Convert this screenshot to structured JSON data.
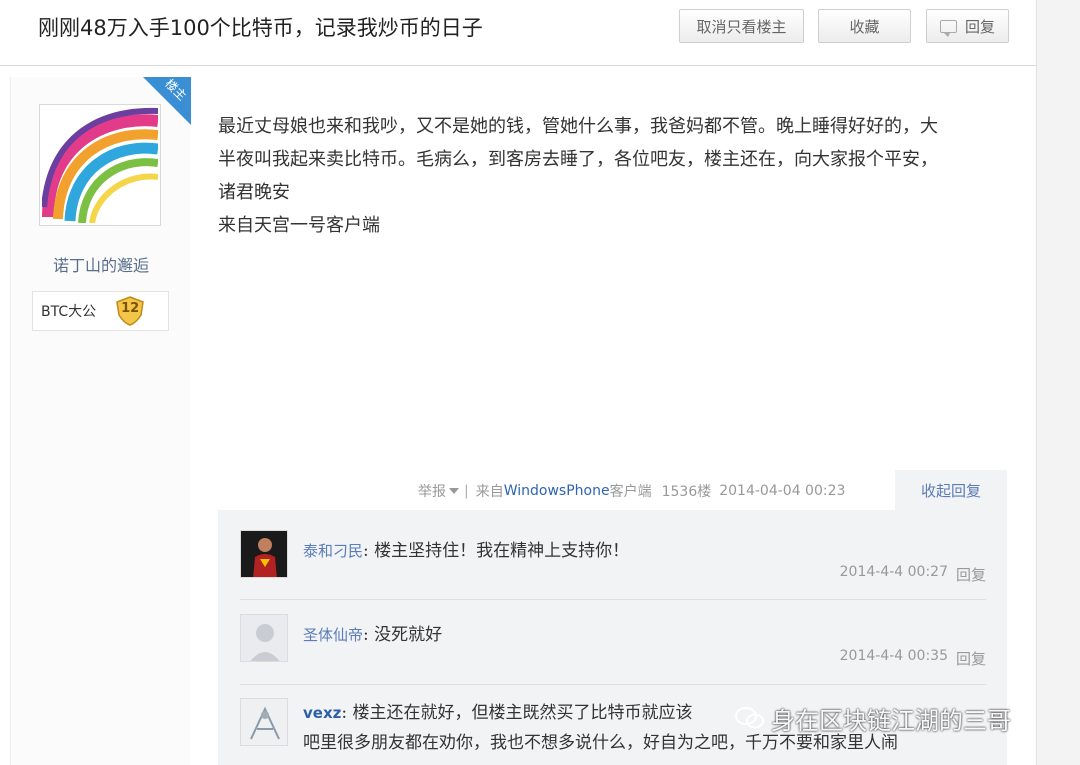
{
  "header": {
    "title": "刚刚48万入手100个比特币，记录我炒币的日子",
    "cancel_only_op_label": "取消只看楼主",
    "favorite_label": "收藏",
    "reply_label": "回复"
  },
  "author": {
    "badge": "楼主",
    "username": "诺丁山的邂逅",
    "level_name": "BTC大公",
    "level": "12"
  },
  "post": {
    "lines": [
      "最近丈母娘也来和我吵，又不是她的钱，管她什么事，我爸妈都不管。晚上睡得好好的，大",
      "半夜叫我起来卖比特币。毛病么，到客房去睡了，各位吧友，楼主还在，向大家报个平安，",
      "诸君晚安",
      "来自天宫一号客户端"
    ],
    "meta": {
      "report_label": "举报",
      "separator": "|",
      "client_prefix": "来自",
      "client_name": "WindowsPhone",
      "client_suffix": "客户端",
      "floor": "1536楼",
      "time": "2014-04-04 00:23",
      "collapse_label": "收起回复"
    }
  },
  "comments": [
    {
      "user": "泰和刁民",
      "text": "楼主坚持住！我在精神上支持你！",
      "time": "2014-4-4 00:27",
      "reply_label": "回复"
    },
    {
      "user": "圣体仙帝",
      "text": "没死就好",
      "time": "2014-4-4 00:35",
      "reply_label": "回复"
    },
    {
      "user": "vexz",
      "text": "楼主还在就好，但楼主既然买了比特币就应该",
      "text_line2": "吧里很多朋友都在劝你，我也不想多说什么，好自为之吧，千万不要和家里人闹"
    }
  ],
  "watermark": {
    "text": "身在区块链江湖的三哥"
  },
  "colors": {
    "op_badge": "#3a8fd4",
    "link_blue": "#5a7cb8",
    "comment_bg": "#f2f3f5"
  }
}
